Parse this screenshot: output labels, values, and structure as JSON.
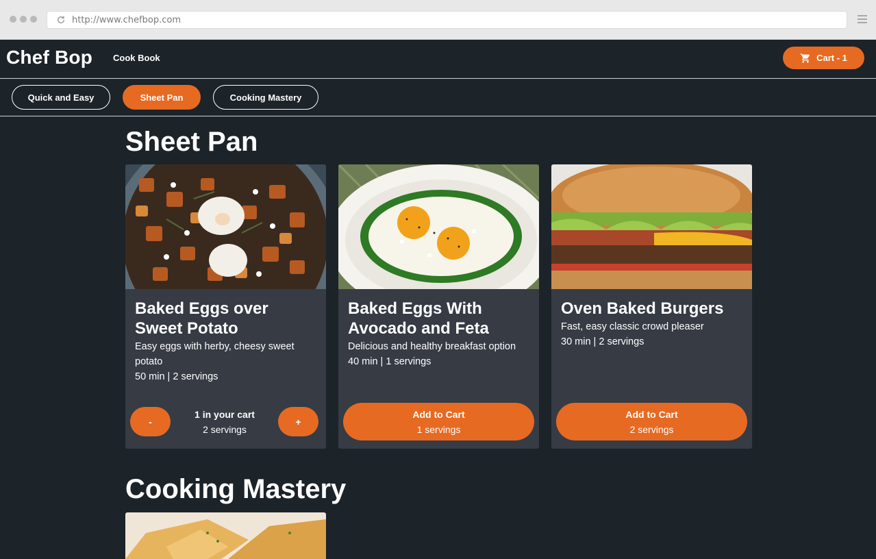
{
  "browser": {
    "url": "http://www.chefbop.com"
  },
  "header": {
    "brand": "Chef Bop",
    "nav_link": "Cook Book",
    "cart_label": "Cart - 1"
  },
  "tabs": [
    {
      "label": "Quick and Easy",
      "active": false
    },
    {
      "label": "Sheet Pan",
      "active": true
    },
    {
      "label": "Cooking Mastery",
      "active": false
    }
  ],
  "sections": {
    "sheet_pan_title": "Sheet Pan",
    "mastery_title": "Cooking Mastery"
  },
  "cards": [
    {
      "title": "Baked Eggs over Sweet Potato",
      "description": "Easy eggs with herby, cheesy sweet potato",
      "meta": "50 min | 2 servings",
      "cart_status": "1 in your cart",
      "cart_servings": "2 servings",
      "minus_label": "-",
      "plus_label": "+"
    },
    {
      "title": "Baked Eggs With Avocado and Feta",
      "description": "Delicious and healthy breakfast option",
      "meta": "40 min | 1 servings",
      "button_label": "Add to Cart",
      "button_servings": "1 servings"
    },
    {
      "title": "Oven Baked Burgers",
      "description": "Fast, easy classic crowd pleaser",
      "meta": "30 min | 2 servings",
      "button_label": "Add to Cart",
      "button_servings": "2 servings"
    }
  ],
  "colors": {
    "background": "#1c2329",
    "accent": "#e66a22",
    "card": "#363b44"
  }
}
